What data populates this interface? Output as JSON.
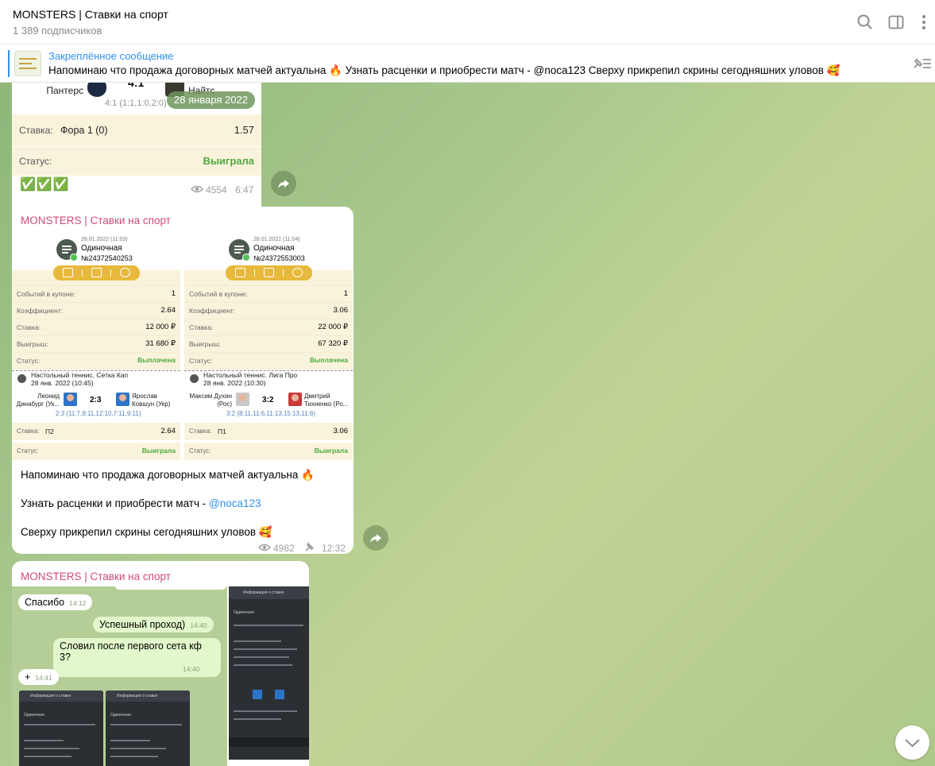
{
  "header": {
    "title": "MONSTERS | Ставки на спорт",
    "subscribers": "1 389 подписчиков"
  },
  "pinned": {
    "title": "Закреплённое сообщение",
    "text": "Напоминаю что продажа договорных матчей актуальна 🔥  Узнать расценки и приобрести матч - @noca123  Сверху прикрепил скрины сегодняшних уловов 🥰"
  },
  "post1": {
    "team_left": "Пантерс",
    "score": "4:1",
    "team_right": "Найтс",
    "sets": "4:1 (1:1,1:0,2:0)",
    "date_pill": "28 января 2022",
    "bet_label": "Ставка:",
    "bet_market": "Фора 1 (0)",
    "bet_odds": "1.57",
    "status_label": "Статус:",
    "status_value": "Выиграла",
    "emojis": "✅✅✅",
    "views": "4554",
    "time": "6:47"
  },
  "post2": {
    "channel": "MONSTERS | Ставки на спорт",
    "coupons": [
      {
        "date": "28.01.2022 (11:03)",
        "type": "Одиночная",
        "number": "№24372540253",
        "rows": [
          {
            "k": "Событий в купоне:",
            "v": "1"
          },
          {
            "k": "Коэффициент:",
            "v": "2.64"
          },
          {
            "k": "Ставка:",
            "v": "12 000 ₽"
          },
          {
            "k": "Выигрыш:",
            "v": "31 680 ₽"
          },
          {
            "k": "Статус:",
            "v": "Выплачена"
          }
        ],
        "league": "Настольный теннис. Сетка Кап",
        "league_date": "28 янв. 2022 (10:45)",
        "player1": "Леонид Динабург (Ук...",
        "score": "2:3",
        "player2": "Ярослав Ковшун (Укр)",
        "sets": "2:3 (11:7,9:11,12:10,7:11,9:11)",
        "bet_label": "Ставка:",
        "bet_market": "П2",
        "bet_odds": "2.64",
        "status_label": "Статус:",
        "status_value": "Выиграла"
      },
      {
        "date": "28.01.2022 (11:04)",
        "type": "Одиночная",
        "number": "№24372553003",
        "rows": [
          {
            "k": "Событий в купоне:",
            "v": "1"
          },
          {
            "k": "Коэффициент:",
            "v": "3.06"
          },
          {
            "k": "Ставка:",
            "v": "22 000 ₽"
          },
          {
            "k": "Выигрыш:",
            "v": "67 320 ₽"
          },
          {
            "k": "Статус:",
            "v": "Выплачена"
          }
        ],
        "league": "Настольный теннис. Лига Про",
        "league_date": "28 янв. 2022 (10:30)",
        "player1": "Максим Духин (Рос)",
        "score": "3:2",
        "player2": "Дмитрий Тихненко (Ро...",
        "sets": "3:2 (8:11,11:6,11:13,15:13,11:6)",
        "bet_label": "Ставка:",
        "bet_market": "П1",
        "bet_odds": "3.06",
        "status_label": "Статус:",
        "status_value": "Выиграла"
      }
    ],
    "line1": "Напоминаю что продажа договорных матчей актуальна 🔥",
    "line2_prefix": "Узнать расценки и приобрести матч - ",
    "line2_link": "@noca123",
    "line3": "Сверху прикрепил скрины сегодняшних уловов 🥰",
    "views": "4982",
    "time": "12:32"
  },
  "post3": {
    "channel": "MONSTERS | Ставки на спорт",
    "chat": [
      {
        "text": "Спасибо",
        "time": "14:12"
      },
      {
        "text": "Успешный проход)",
        "time": "14:40"
      },
      {
        "text": "Словил после первого сета кф 3?",
        "time": "14:40"
      },
      {
        "text": "+",
        "time": "14:41"
      }
    ],
    "phone_title": "Информация о ставке",
    "phone_type": "Одиночная"
  },
  "colors": {
    "accent": "#3390ec",
    "channel_name": "#d14a75",
    "win_green": "#4caa3c",
    "coupon_yellow": "#e7b93c"
  }
}
